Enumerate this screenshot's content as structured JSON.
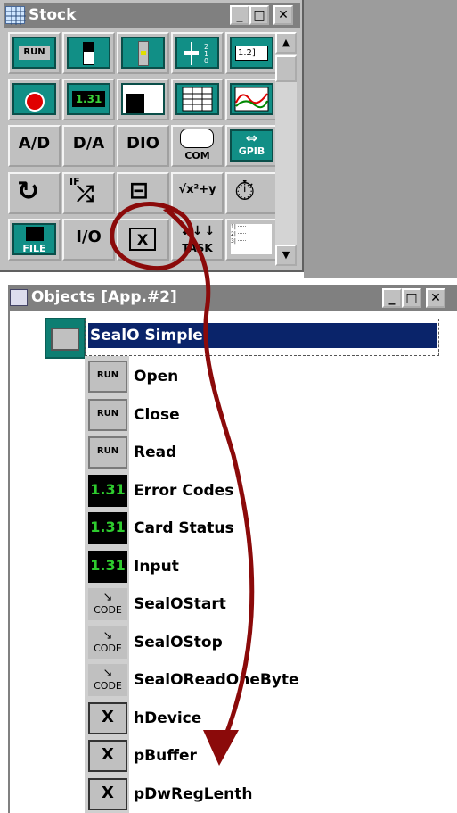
{
  "stock_window": {
    "title": "Stock",
    "buttons": {
      "minimize": "_",
      "maximize": "□",
      "close": "✕"
    },
    "tiles_row1": [
      "RUN",
      "",
      "",
      "",
      "1.2]"
    ],
    "tiles_row2": [
      "",
      "1.31",
      "",
      "",
      ""
    ],
    "tiles_row3": [
      "A/D",
      "D/A",
      "DIO",
      "COM",
      "GPIB"
    ],
    "tiles_row4": [
      "",
      "IF",
      "",
      "√x²+y",
      ""
    ],
    "tiles_row5": [
      "FILE",
      "I/O",
      "X",
      "TASK",
      ""
    ]
  },
  "objects_window": {
    "title": "Objects [App.#2]",
    "buttons": {
      "minimize": "_",
      "maximize": "□",
      "close": "✕"
    },
    "root_item": "SealO Simple",
    "items": [
      {
        "icon": "RUN",
        "label": "Open"
      },
      {
        "icon": "RUN",
        "label": "Close"
      },
      {
        "icon": "RUN",
        "label": "Read"
      },
      {
        "icon": "1.31",
        "label": "Error Codes"
      },
      {
        "icon": "1.31",
        "label": "Card Status"
      },
      {
        "icon": "1.31",
        "label": "Input"
      },
      {
        "icon": "CODE",
        "label": "SealOStart"
      },
      {
        "icon": "CODE",
        "label": "SealOStop"
      },
      {
        "icon": "CODE",
        "label": "SealOReadOneByte"
      },
      {
        "icon": "X",
        "label": "hDevice"
      },
      {
        "icon": "X",
        "label": "pBuffer"
      },
      {
        "icon": "X",
        "label": "pDwRegLenth"
      }
    ]
  },
  "colors": {
    "annotation_arrow": "#8b0a0a",
    "teal_icon": "#118f86",
    "selection": "#0a246a"
  }
}
